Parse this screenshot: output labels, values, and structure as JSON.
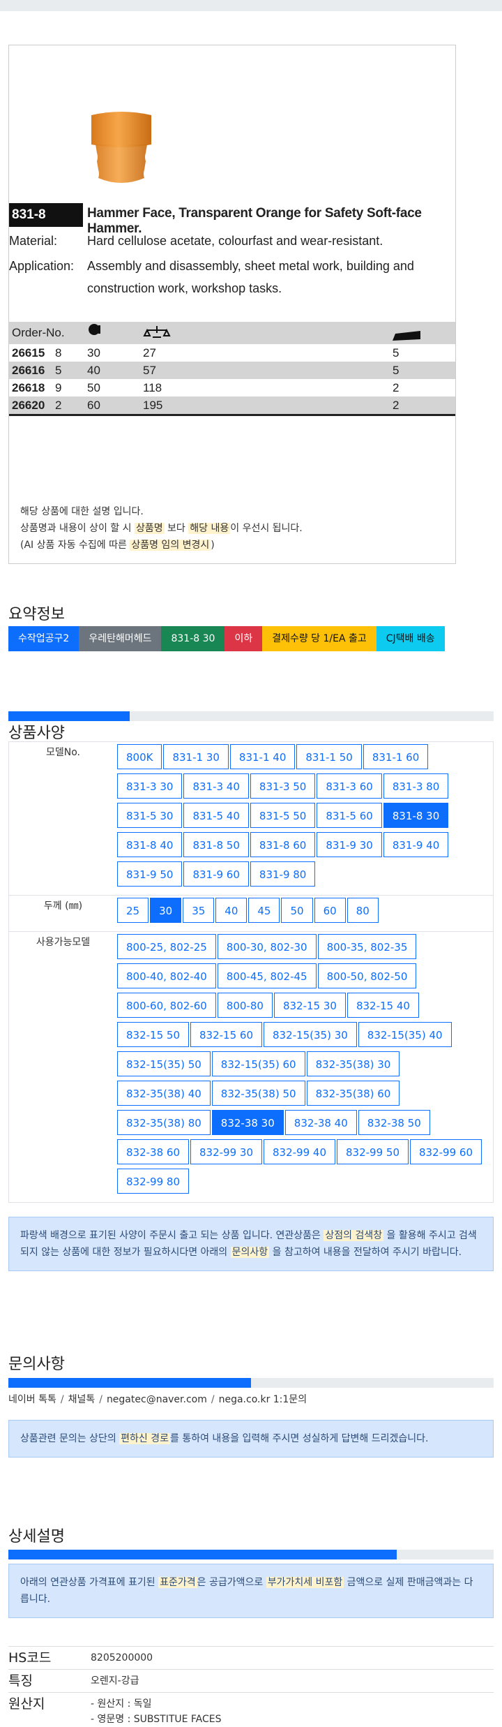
{
  "catalog": {
    "code": "831-8",
    "title": "Hammer Face, Transparent Orange for Safety Soft-face Hammer.",
    "material_label": "Material:",
    "material_text": "Hard cellulose acetate, colourfast and wear-resistant.",
    "application_label": "Application:",
    "application_text": "Assembly and disassembly, sheet metal work, building and construction work, workshop tasks.",
    "header_order": "Order-No.",
    "rows": [
      {
        "order": "26615",
        "check": "8",
        "dia": "30",
        "weight": "27",
        "qty": "5"
      },
      {
        "order": "26616",
        "check": "5",
        "dia": "40",
        "weight": "57",
        "qty": "5"
      },
      {
        "order": "26618",
        "check": "9",
        "dia": "50",
        "weight": "118",
        "qty": "2"
      },
      {
        "order": "26620",
        "check": "2",
        "dia": "60",
        "weight": "195",
        "qty": "2"
      }
    ]
  },
  "note": {
    "line1": "해당 상품에 대한 설명 입니다.",
    "line2_a": "상품명과 내용이 상이 할 시 ",
    "line2_hl1": "상품명",
    "line2_b": " 보다 ",
    "line2_hl2": "해당 내용",
    "line2_c": "이 우선시 됩니다.",
    "line3_a": "(AI 상품 자동 수집에 따른 ",
    "line3_hl": "상품명 임의 변경시",
    "line3_b": ")"
  },
  "summary": {
    "title": "요약정보",
    "tags": [
      {
        "label": "수작업공구2",
        "color": "#0d6efd"
      },
      {
        "label": "우레탄해머헤드",
        "color": "#6c757d"
      },
      {
        "label": "831-8 30",
        "color": "#198754"
      },
      {
        "label": "이하",
        "color": "#dc3545"
      },
      {
        "label": "결제수량 당 1/EA 출고",
        "color": "#ffc107"
      },
      {
        "label": "CJ택배 배송",
        "color": "#0dcaf0"
      }
    ]
  },
  "spec": {
    "title": "상품사양",
    "progress": 0.25,
    "model_label": "모델No.",
    "models": [
      "800K",
      "831-1 30",
      "831-1 40",
      "831-1 50",
      "831-1 60",
      "831-3 30",
      "831-3 40",
      "831-3 50",
      "831-3 60",
      "831-3 80",
      "831-5 30",
      "831-5 40",
      "831-5 50",
      "831-5 60",
      "831-8 30",
      "831-8 40",
      "831-8 50",
      "831-8 60",
      "831-9 30",
      "831-9 40",
      "831-9 50",
      "831-9 60",
      "831-9 80"
    ],
    "model_selected": "831-8 30",
    "thickness_label": "두께 (㎜)",
    "thicknesses": [
      "25",
      "30",
      "35",
      "40",
      "45",
      "50",
      "60",
      "80"
    ],
    "thickness_selected": "30",
    "compatible_label": "사용가능모델",
    "compatibles": [
      "800-25, 802-25",
      "800-30, 802-30",
      "800-35, 802-35",
      "800-40, 802-40",
      "800-45, 802-45",
      "800-50, 802-50",
      "800-60, 802-60",
      "800-80",
      "832-15 30",
      "832-15 40",
      "832-15 50",
      "832-15 60",
      "832-15(35) 30",
      "832-15(35) 40",
      "832-15(35) 50",
      "832-15(35) 60",
      "832-35(38) 30",
      "832-35(38) 40",
      "832-35(38) 50",
      "832-35(38) 60",
      "832-35(38) 80",
      "832-38 30",
      "832-38 40",
      "832-38 50",
      "832-38 60",
      "832-99 30",
      "832-99 40",
      "832-99 50",
      "832-99 60",
      "832-99 80"
    ],
    "compatible_selected": "832-38 30",
    "info_a": "파랑색 배경으로 표기된 사양이 주문시 출고 되는 상품 입니다. 연관상품은 ",
    "info_hl1": "상점의 검색창",
    "info_b": " 을 활용해 주시고 검색되지 않는 상품에 대한 정보가 필요하시다면 아래의 ",
    "info_hl2": "문의사항",
    "info_c": " 을 참고하여 내용을 전달하여 주시기 바랍니다."
  },
  "inquiry": {
    "title": "문의사항",
    "progress": 0.5,
    "contacts": [
      "네이버 톡톡",
      "채널톡",
      "negatec@naver.com",
      "nega.co.kr 1:1문의"
    ],
    "info_a": "상품관련 문의는 상단의 ",
    "info_hl": "편하신 경로",
    "info_b": "를 통하여 내용을 입력해 주시면 성실하게 답변해 드리겠습니다."
  },
  "detail": {
    "title": "상세설명",
    "progress": 0.8,
    "info_a": "아래의 연관상품 가격표에 표기된 ",
    "info_hl1": "표준가격",
    "info_b": "은 공급가액으로 ",
    "info_hl2": "부가가치세 비포함",
    "info_c": " 금액으로 실제 판매금액과는 다릅니다.",
    "hs_label": "HS코드",
    "hs_value": "8205200000",
    "feature_label": "특징",
    "feature_value": "오렌지-강급",
    "origin_label": "원산지",
    "origin_line1": "- 원산지 : 독일",
    "origin_line2": "- 영문명 : SUBSTITUE FACES"
  }
}
